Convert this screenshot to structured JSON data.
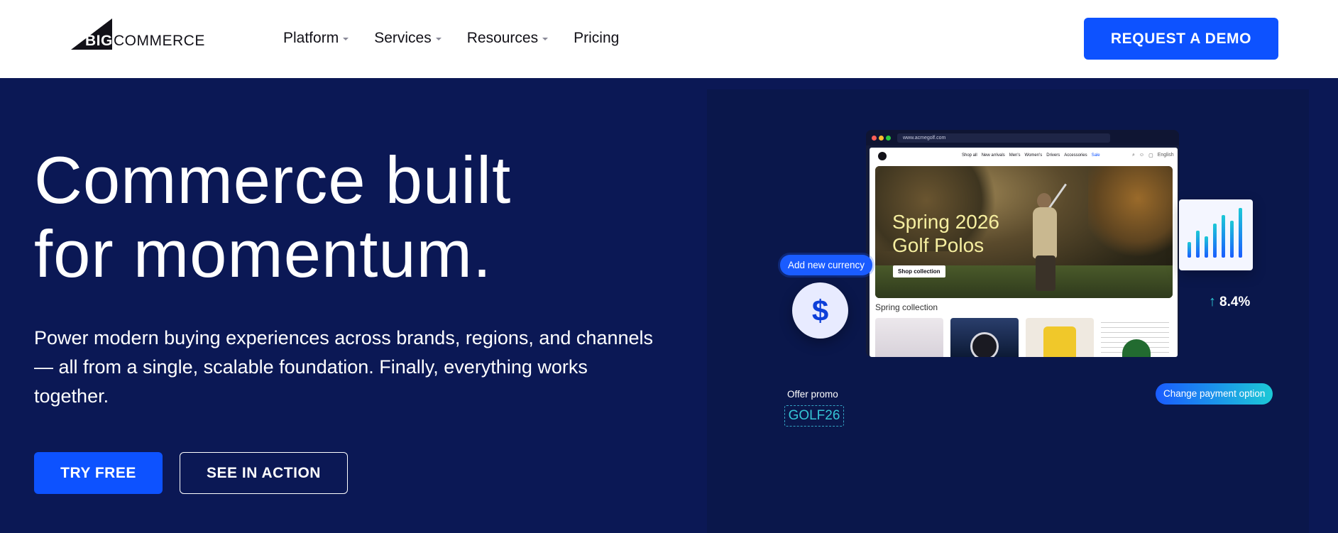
{
  "header": {
    "logo_big": "BIG",
    "logo_commerce": "COMMERCE",
    "nav": [
      {
        "label": "Platform",
        "has_caret": true
      },
      {
        "label": "Services",
        "has_caret": true
      },
      {
        "label": "Resources",
        "has_caret": true
      },
      {
        "label": "Pricing",
        "has_caret": false
      }
    ],
    "demo_button": "REQUEST A DEMO"
  },
  "hero": {
    "headline_line1": "Commerce built",
    "headline_line2": "for momentum.",
    "subtext": "Power modern buying experiences across brands, regions, and channels — all from a single, scalable foundation. Finally, everything works together.",
    "try_free": "TRY FREE",
    "see_in_action": "SEE IN ACTION"
  },
  "mockup": {
    "url": "www.acmegolf.com",
    "nav_links": [
      "Shop all",
      "New arrivals",
      "Men's",
      "Women's",
      "Drivers",
      "Accessories",
      "Sale"
    ],
    "language": "English",
    "promo_title_line1": "Spring 2026",
    "promo_title_line2": "Golf Polos",
    "shop_button": "Shop collection",
    "collection_label": "Spring collection"
  },
  "badges": {
    "add_currency": "Add new currency",
    "currency_symbol": "$",
    "offer_label": "Offer promo",
    "offer_code": "GOLF26",
    "growth_arrow": "↑",
    "growth_value": "8.4%",
    "change_payment": "Change payment option"
  },
  "colors": {
    "brand_blue": "#0d52ff",
    "hero_bg": "#0b1855",
    "accent_teal": "#1cc9d6"
  }
}
